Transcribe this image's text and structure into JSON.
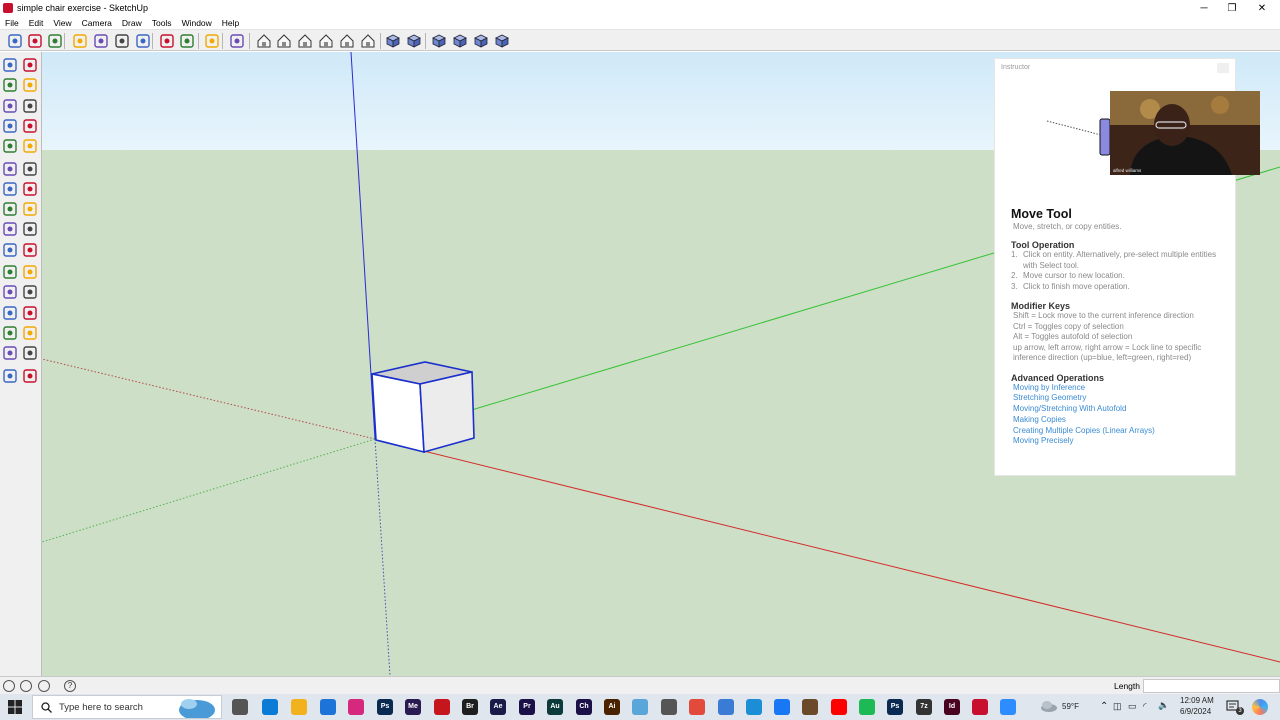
{
  "window": {
    "title": "simple chair exercise - SketchUp",
    "controls": {
      "minimize": "─",
      "restore": "❐",
      "close": "✕"
    }
  },
  "menu": [
    "File",
    "Edit",
    "View",
    "Camera",
    "Draw",
    "Tools",
    "Window",
    "Help"
  ],
  "toolbar_icons": [
    "new-icon",
    "open-icon",
    "save-icon",
    "cut-icon",
    "copy-icon",
    "paste-icon",
    "erase-icon",
    "undo-icon",
    "redo-icon",
    "print-icon",
    "model-info-icon",
    "iso-view-icon",
    "top-view-icon",
    "front-view-icon",
    "right-view-icon",
    "back-view-icon",
    "left-view-icon",
    "xray-icon",
    "wireframe-icon",
    "hidden-line-icon",
    "shaded-icon",
    "shaded-textures-icon",
    "monochrome-icon"
  ],
  "left_tools": [
    "select-icon",
    "make-component-icon",
    "paint-bucket-icon",
    "eraser-icon",
    "rectangle-icon",
    "line-icon",
    "circle-icon",
    "arc-icon",
    "polygon-icon",
    "freehand-icon",
    "move-icon",
    "push-pull-icon",
    "rotate-icon",
    "follow-me-icon",
    "scale-icon",
    "offset-icon",
    "tape-measure-icon",
    "dimension-icon",
    "protractor-icon",
    "text-icon",
    "axes-icon",
    "3d-text-icon",
    "orbit-icon",
    "pan-icon",
    "zoom-icon",
    "zoom-extents-icon",
    "previous-view-icon",
    "next-view-icon",
    "position-camera-icon",
    "look-around-icon",
    "walk-icon",
    "section-plane-icon"
  ],
  "instructor": {
    "panel_title": "Instructor",
    "webcam_name": "alfred williams",
    "title": "Move Tool",
    "subtitle": "Move, stretch, or copy entities.",
    "operation_heading": "Tool Operation",
    "operations": [
      {
        "num": "1.",
        "text": "Click on entity. Alternatively, pre-select multiple entities with Select tool."
      },
      {
        "num": "2.",
        "text": "Move cursor to new location."
      },
      {
        "num": "3.",
        "text": "Click to finish move operation."
      }
    ],
    "modifier_heading": "Modifier Keys",
    "modifiers": [
      "Shift = Lock move to the current inference direction",
      "Ctrl = Toggles copy of selection",
      "Alt = Toggles autofold of selection",
      "up arrow, left arrow, right arrow = Lock line to specific inference direction (up=blue, left=green, right=red)"
    ],
    "advanced_heading": "Advanced Operations",
    "advanced_links": [
      "Moving by Inference",
      "Stretching Geometry",
      "Moving/Stretching With Autofold",
      "Making Copies",
      "Creating Multiple Copies (Linear Arrays)",
      "Moving Precisely"
    ]
  },
  "statusbar": {
    "length_label": "Length",
    "length_value": ""
  },
  "taskbar": {
    "search_placeholder": "Type here to search",
    "apps": [
      {
        "name": "task-view-icon",
        "label": "",
        "color": "#555555"
      },
      {
        "name": "edge-icon",
        "label": "",
        "color": "#0c7bd6"
      },
      {
        "name": "file-explorer-icon",
        "label": "",
        "color": "#f2b21d"
      },
      {
        "name": "mail-icon",
        "label": "",
        "color": "#1e73d8"
      },
      {
        "name": "instagram-icon",
        "label": "",
        "color": "#d6287c"
      },
      {
        "name": "photoshop-icon",
        "label": "Ps",
        "color": "#0a2a52"
      },
      {
        "name": "media-encoder-icon",
        "label": "Me",
        "color": "#2a1a52"
      },
      {
        "name": "acrobat-icon",
        "label": "",
        "color": "#c4161c"
      },
      {
        "name": "bridge-icon",
        "label": "Br",
        "color": "#1e1e1e"
      },
      {
        "name": "after-effects-icon",
        "label": "Ae",
        "color": "#1b1b4a"
      },
      {
        "name": "premiere-icon",
        "label": "Pr",
        "color": "#1b1048"
      },
      {
        "name": "audition-icon",
        "label": "Au",
        "color": "#0b3b3a"
      },
      {
        "name": "character-animator-icon",
        "label": "Ch",
        "color": "#1b1048"
      },
      {
        "name": "illustrator-icon",
        "label": "Ai",
        "color": "#4a2200"
      },
      {
        "name": "paint-icon",
        "label": "",
        "color": "#5aa6d9"
      },
      {
        "name": "calculator-icon",
        "label": "",
        "color": "#555555"
      },
      {
        "name": "chrome-icon",
        "label": "",
        "color": "#e24b3b"
      },
      {
        "name": "camera-raw-icon",
        "label": "",
        "color": "#3a7bd5"
      },
      {
        "name": "edge-beta-icon",
        "label": "",
        "color": "#1c8ed8"
      },
      {
        "name": "facebook-icon",
        "label": "",
        "color": "#1877f2"
      },
      {
        "name": "photo-icon",
        "label": "",
        "color": "#6b4a2a"
      },
      {
        "name": "youtube-icon",
        "label": "",
        "color": "#ff0000"
      },
      {
        "name": "spotify-icon",
        "label": "",
        "color": "#1db954"
      },
      {
        "name": "photoshop-2-icon",
        "label": "Ps",
        "color": "#0a2a52"
      },
      {
        "name": "7zip-icon",
        "label": "7z",
        "color": "#333333"
      },
      {
        "name": "indesign-icon",
        "label": "Id",
        "color": "#49021f"
      },
      {
        "name": "sketchup-icon",
        "label": "",
        "color": "#c8102e"
      },
      {
        "name": "zoom-icon",
        "label": "",
        "color": "#2d8cff"
      }
    ],
    "weather": "59°F",
    "time": "12:09 AM",
    "date": "6/9/2024",
    "notification_count": "3"
  },
  "colors": {
    "sky": "#dff1fb",
    "ground": "#cddfc6",
    "red_axis": "#d42a2a",
    "green_axis": "#34c234",
    "blue_axis": "#2a2ad4",
    "link": "#3b8bd4"
  }
}
